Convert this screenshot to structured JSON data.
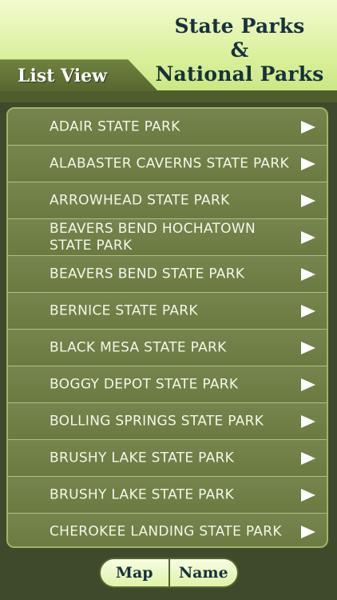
{
  "header": {
    "title_line1": "State Parks",
    "title_line2": "&",
    "title_line3": "National Parks",
    "view_tab_label": "List View"
  },
  "parks": [
    "ADAIR STATE PARK",
    "ALABASTER CAVERNS STATE PARK",
    "ARROWHEAD STATE PARK",
    "BEAVERS BEND HOCHATOWN STATE PARK",
    "BEAVERS BEND STATE PARK",
    "BERNICE STATE PARK",
    "BLACK MESA STATE PARK",
    "BOGGY DEPOT STATE PARK",
    "BOLLING SPRINGS STATE PARK",
    "BRUSHY LAKE STATE PARK",
    "BRUSHY LAKE STATE PARK",
    "CHEROKEE LANDING STATE PARK"
  ],
  "footer": {
    "map_label": "Map",
    "name_label": "Name"
  },
  "colors": {
    "header_gradient_top": "#f3fbd0",
    "header_gradient_bottom": "#c6e47c",
    "list_background": "#6e7e47",
    "app_background": "#3f4a2c",
    "title_text": "#17323d"
  },
  "icons": {
    "row_arrow": "chevron-right-icon"
  }
}
